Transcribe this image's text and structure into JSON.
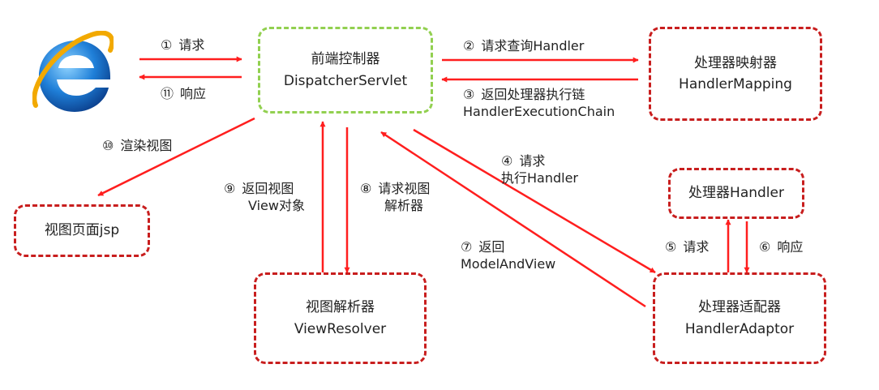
{
  "colors": {
    "arrow": "#ff1e1e",
    "box_border": "#c81e1e",
    "front_border": "#92d050"
  },
  "browser": {
    "icon": "internet-explorer-icon"
  },
  "nodes": {
    "dispatcher": {
      "line1": "前端控制器",
      "line2": "DispatcherServlet"
    },
    "handler_mapping": {
      "line1": "处理器映射器",
      "line2": "HandlerMapping"
    },
    "handler": {
      "line1": "处理器Handler"
    },
    "handler_adaptor": {
      "line1": "处理器适配器",
      "line2": "HandlerAdaptor"
    },
    "view_resolver": {
      "line1": "视图解析器",
      "line2": "ViewResolver"
    },
    "view_page": {
      "line1": "视图页面jsp"
    }
  },
  "steps": {
    "s1": {
      "num": "①",
      "line1": "请求"
    },
    "s2": {
      "num": "②",
      "line1": "请求查询Handler"
    },
    "s3": {
      "num": "③",
      "line1": "返回处理器执行链",
      "line2": "HandlerExecutionChain"
    },
    "s4": {
      "num": "④",
      "line1": "请求",
      "line2": "执行Handler"
    },
    "s5": {
      "num": "⑤",
      "line1": "请求"
    },
    "s6": {
      "num": "⑥",
      "line1": "响应"
    },
    "s7": {
      "num": "⑦",
      "line1": "返回",
      "line2": "ModelAndView"
    },
    "s8": {
      "num": "⑧",
      "line1": "请求视图",
      "line2": "解析器"
    },
    "s9": {
      "num": "⑨",
      "line1": "返回视图",
      "line2": "View对象"
    },
    "s10": {
      "num": "⑩",
      "line1": "渲染视图"
    },
    "s11": {
      "num": "⑪",
      "line1": "响应"
    }
  }
}
